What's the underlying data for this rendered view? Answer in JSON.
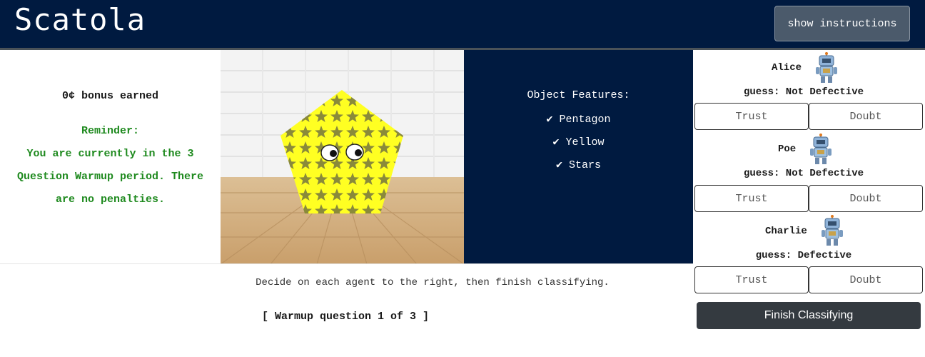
{
  "app": {
    "title": "Scatola",
    "instructions_button": "show instructions"
  },
  "status": {
    "bonus": "0¢ bonus earned",
    "reminder_label": "Reminder:",
    "reminder_line1": "You are currently in the 3",
    "reminder_line2": "Question Warmup period. There",
    "reminder_line3": "are no penalties."
  },
  "features": {
    "title": "Object Features:",
    "items": [
      "✔ Pentagon",
      "✔ Yellow",
      "✔ Stars"
    ]
  },
  "agents": [
    {
      "name": "Alice",
      "guess": "guess: Not Defective",
      "trust_label": "Trust",
      "doubt_label": "Doubt"
    },
    {
      "name": "Poe",
      "guess": "guess: Not Defective",
      "trust_label": "Trust",
      "doubt_label": "Doubt"
    },
    {
      "name": "Charlie",
      "guess": "guess: Defective",
      "trust_label": "Trust",
      "doubt_label": "Doubt"
    }
  ],
  "footer": {
    "instruction": "Decide on each agent to the right, then finish classifying.",
    "progress": "[ Warmup question 1 of 3 ]",
    "finish_button": "Finish Classifying"
  },
  "colors": {
    "navy": "#001a40",
    "reminder_green": "#1f8a1f",
    "object_yellow": "#ffff22",
    "star_olive": "#8a8a3a",
    "dark_button": "#343a40"
  },
  "icons": {
    "robot": "robot-icon",
    "check": "check-icon"
  }
}
